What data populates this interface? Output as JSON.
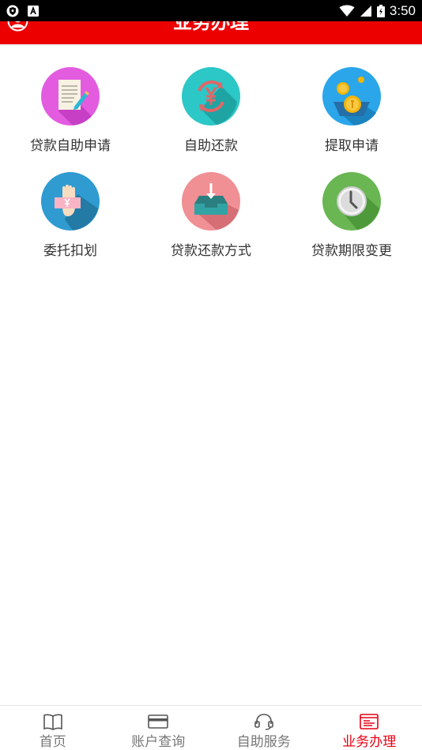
{
  "status_bar": {
    "time": "3:50"
  },
  "header": {
    "title": "业务办理"
  },
  "services": [
    {
      "label": "贷款自助申请",
      "icon": "document-pen-icon"
    },
    {
      "label": "自助还款",
      "icon": "yen-refresh-icon"
    },
    {
      "label": "提取申请",
      "icon": "coins-withdraw-icon"
    },
    {
      "label": "委托扣划",
      "icon": "hand-cash-icon"
    },
    {
      "label": "贷款还款方式",
      "icon": "inbox-download-icon"
    },
    {
      "label": "贷款期限变更",
      "icon": "clock-icon"
    }
  ],
  "tabs": [
    {
      "label": "首页",
      "icon": "book-icon",
      "active": false
    },
    {
      "label": "账户查询",
      "icon": "card-icon",
      "active": false
    },
    {
      "label": "自助服务",
      "icon": "headset-icon",
      "active": false
    },
    {
      "label": "业务办理",
      "icon": "form-icon",
      "active": true
    }
  ],
  "colors": {
    "header": "#ec0000",
    "active_tab": "#e60012"
  }
}
